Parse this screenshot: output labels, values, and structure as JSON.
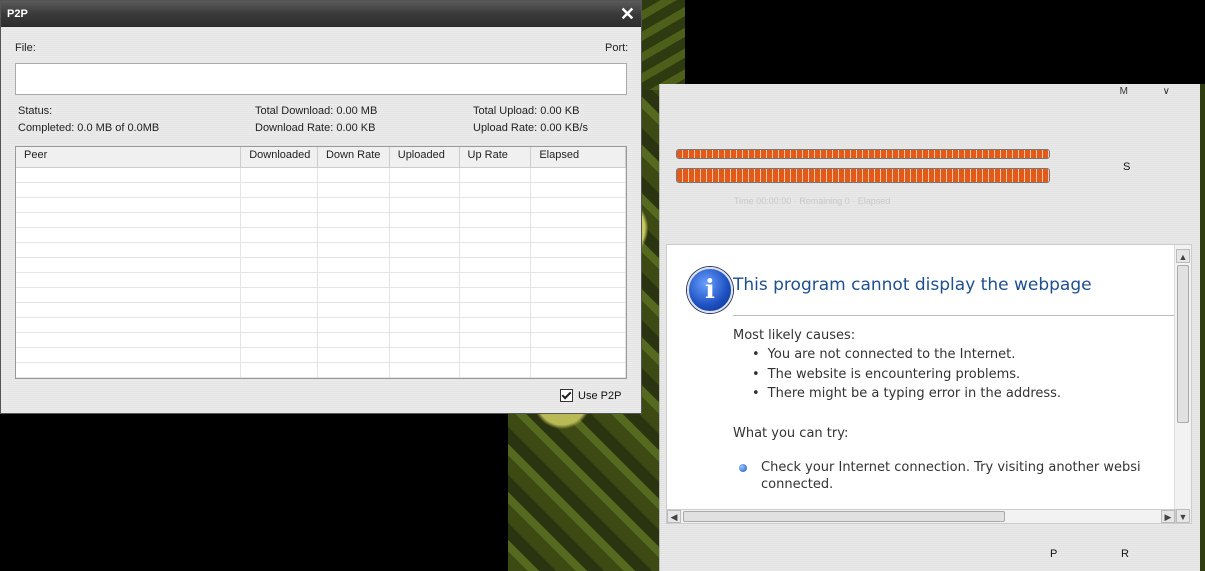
{
  "p2p": {
    "title": "P2P",
    "close": "✕",
    "file_label": "File:",
    "port_label": "Port:",
    "file_value": "",
    "status_label": "Status:",
    "completed": "Completed: 0.0 MB of 0.0MB",
    "total_download": "Total Download: 0.00 MB",
    "download_rate": "Download Rate: 0.00 KB",
    "total_upload": "Total Upload: 0.00 KB",
    "upload_rate": "Upload Rate: 0.00 KB/s",
    "columns": [
      "Peer",
      "Downloaded",
      "Down Rate",
      "Uploaded",
      "Up Rate",
      "Elapsed"
    ],
    "use_p2p_label": "Use P2P",
    "use_p2p_checked": true
  },
  "launcher": {
    "top_controls": "M ∨",
    "side_label": "S",
    "faint_text": "Time 00:00:00 · Remaining 0 · Elapsed",
    "bottom_p": "P",
    "bottom_r": "R",
    "progress_1": 1.0,
    "progress_2": 1.0
  },
  "browser": {
    "title": "This program cannot display the webpage",
    "causes_heading": "Most likely causes:",
    "causes": [
      "You are not connected to the Internet.",
      "The website is encountering problems.",
      "There might be a typing error in the address."
    ],
    "try_heading": "What you can try:",
    "try_item": "Check your Internet connection. Try visiting another websi",
    "try_item_2": "connected."
  },
  "colors": {
    "title_blue": "#1e4f8f",
    "progress_orange": "#e15a1a"
  }
}
